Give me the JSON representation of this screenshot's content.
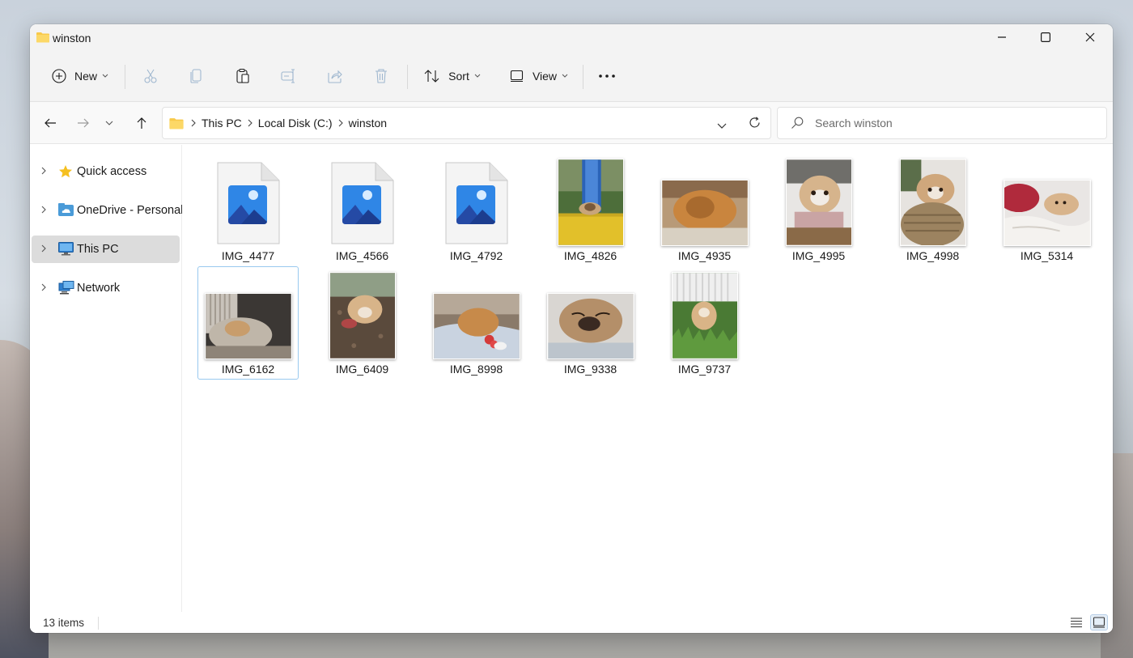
{
  "window": {
    "title": "winston"
  },
  "toolbar": {
    "new_label": "New",
    "sort_label": "Sort",
    "view_label": "View",
    "icons": [
      "cut-icon",
      "copy-icon",
      "paste-icon",
      "rename-icon",
      "share-icon",
      "delete-icon",
      "more-icon"
    ]
  },
  "address": {
    "crumbs": [
      "This PC",
      "Local Disk (C:)",
      "winston"
    ]
  },
  "search": {
    "placeholder": "Search winston"
  },
  "sidebar": {
    "items": [
      {
        "label": "Quick access",
        "icon": "star-icon"
      },
      {
        "label": "OneDrive - Personal",
        "icon": "onedrive-icon"
      },
      {
        "label": "This PC",
        "icon": "pc-icon",
        "selected": true
      },
      {
        "label": "Network",
        "icon": "network-icon"
      }
    ]
  },
  "files": [
    {
      "name": "IMG_4477",
      "kind": "generic"
    },
    {
      "name": "IMG_4566",
      "kind": "generic"
    },
    {
      "name": "IMG_4792",
      "kind": "generic"
    },
    {
      "name": "IMG_4826",
      "kind": "photo"
    },
    {
      "name": "IMG_4935",
      "kind": "photo"
    },
    {
      "name": "IMG_4995",
      "kind": "photo"
    },
    {
      "name": "IMG_4998",
      "kind": "photo"
    },
    {
      "name": "IMG_5314",
      "kind": "photo"
    },
    {
      "name": "IMG_6162",
      "kind": "photo",
      "selected": true
    },
    {
      "name": "IMG_6409",
      "kind": "photo"
    },
    {
      "name": "IMG_8998",
      "kind": "photo"
    },
    {
      "name": "IMG_9338",
      "kind": "photo"
    },
    {
      "name": "IMG_9737",
      "kind": "photo"
    }
  ],
  "status": {
    "count": "13 items"
  },
  "colors": {
    "accent": "#0067c0",
    "folder": "#f8c94a",
    "selection": "#99c9ef"
  }
}
